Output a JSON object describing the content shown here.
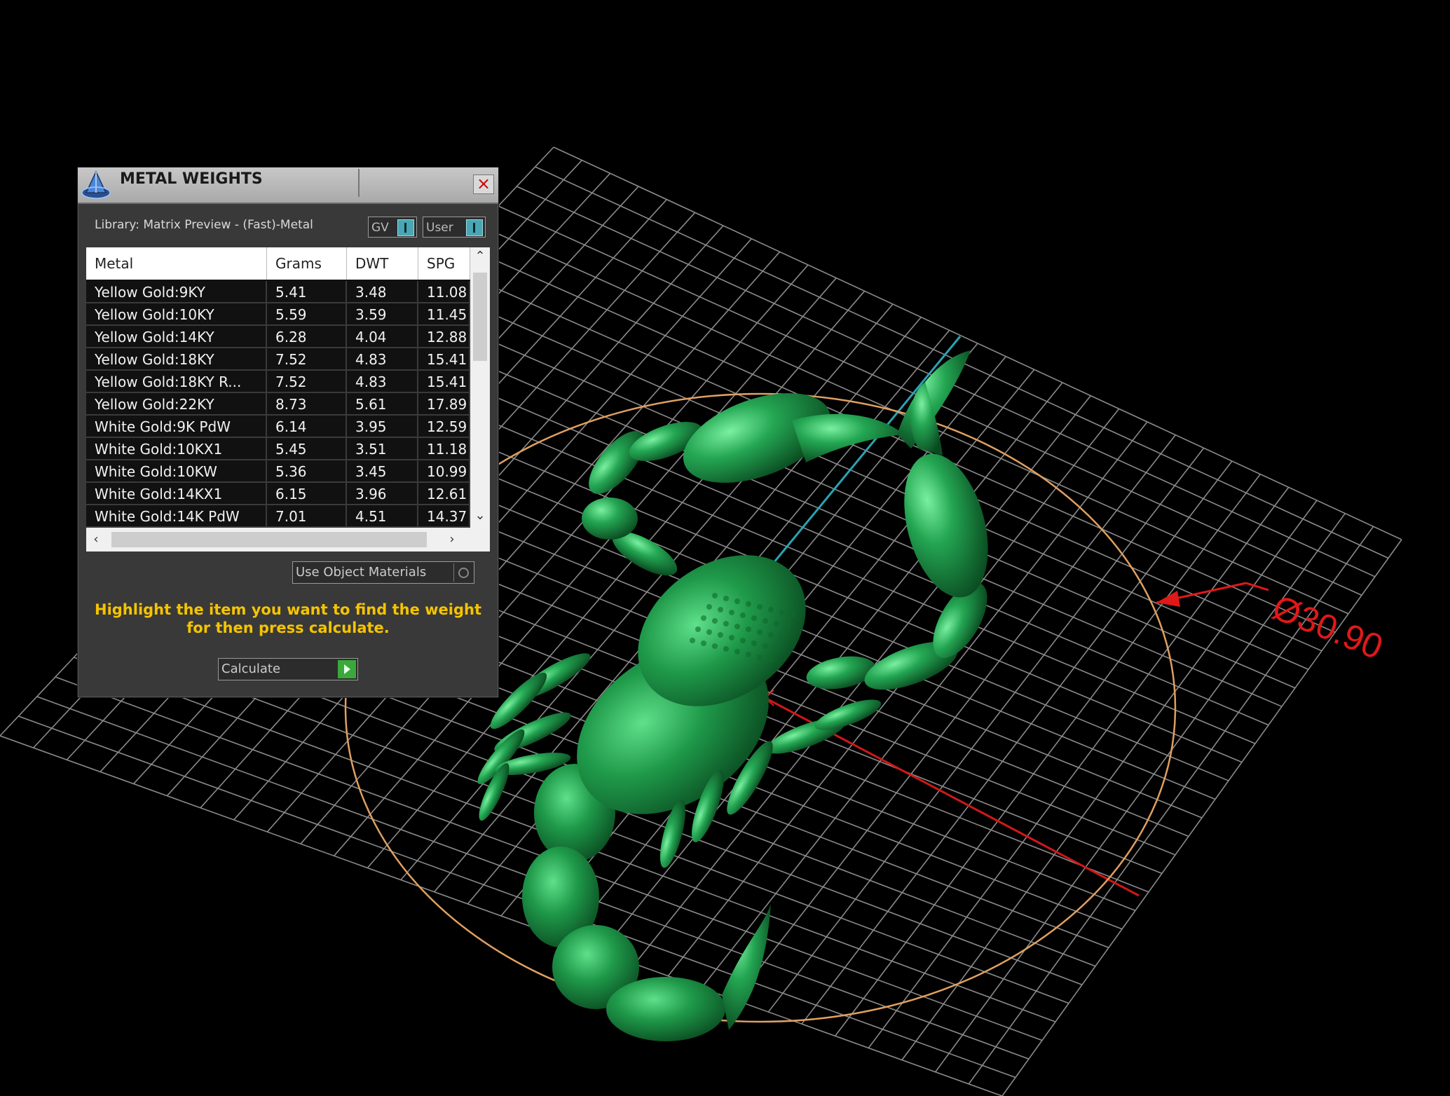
{
  "panel": {
    "title": "METAL WEIGHTS",
    "close_symbol": "×",
    "library_label": "Library: Matrix Preview - (Fast)-Metal",
    "toggles": {
      "gv": "GV",
      "user": "User"
    },
    "table": {
      "headers": [
        "Metal",
        "Grams",
        "DWT",
        "SPG"
      ],
      "rows": [
        [
          "Yellow Gold:9KY",
          "5.41",
          "3.48",
          "11.08"
        ],
        [
          "Yellow Gold:10KY",
          "5.59",
          "3.59",
          "11.45"
        ],
        [
          "Yellow Gold:14KY",
          "6.28",
          "4.04",
          "12.88"
        ],
        [
          "Yellow Gold:18KY",
          "7.52",
          "4.83",
          "15.41"
        ],
        [
          "Yellow Gold:18KY R...",
          "7.52",
          "4.83",
          "15.41"
        ],
        [
          "Yellow Gold:22KY",
          "8.73",
          "5.61",
          "17.89"
        ],
        [
          "White Gold:9K PdW",
          "6.14",
          "3.95",
          "12.59"
        ],
        [
          "White Gold:10KX1",
          "5.45",
          "3.51",
          "11.18"
        ],
        [
          "White Gold:10KW",
          "5.36",
          "3.45",
          "10.99"
        ],
        [
          "White Gold:14KX1",
          "6.15",
          "3.96",
          "12.61"
        ],
        [
          "White Gold:14K PdW",
          "7.01",
          "4.51",
          "14.37"
        ]
      ]
    },
    "use_object_materials": "Use Object Materials",
    "hint_line1": "Highlight the item you want to find the weight",
    "hint_line2": "for then press calculate.",
    "calculate_label": "Calculate"
  },
  "viewport": {
    "dimension_label": "Ø30.90",
    "model": "scorpion",
    "colors": {
      "model": "#1f9a4a",
      "grid": "#9a9a9a",
      "circle": "#e0a060",
      "dimension": "#e01818",
      "axis_y": "#2aa3b3"
    }
  }
}
